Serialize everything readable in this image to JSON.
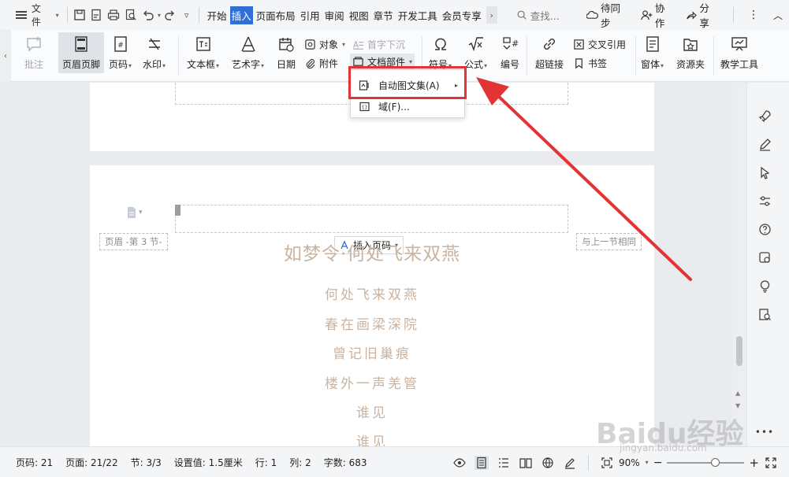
{
  "menubar": {
    "file_label": "文件",
    "tabs": [
      "开始",
      "插入",
      "页面布局",
      "引用",
      "审阅",
      "视图",
      "章节",
      "开发工具",
      "会员专享"
    ],
    "active_tab": "插入",
    "search_placeholder": "查找...",
    "sync_label": "待同步",
    "collab_label": "协作",
    "share_label": "分享"
  },
  "ribbon": {
    "comment": "批注",
    "header_footer": "页眉页脚",
    "page_number": "页码",
    "watermark": "水印",
    "textbox": "文本框",
    "wordart": "艺术字",
    "date": "日期",
    "object": "对象",
    "attachment": "附件",
    "drop_cap": "首字下沉",
    "doc_parts": "文档部件",
    "symbol": "符号",
    "formula": "公式",
    "numbering": "编号",
    "hyperlink": "超链接",
    "cross_ref": "交叉引用",
    "bookmark": "书签",
    "form": "窗体",
    "resources": "资源夹",
    "teaching_tools": "教学工具"
  },
  "dropdown": {
    "items": [
      "自动图文集(A)",
      "域(F)..."
    ]
  },
  "document": {
    "header_label": "页眉  -第 3 节-",
    "insert_page_number": "插入页码",
    "same_as_prev": "与上一节相同",
    "title": "如梦令·何处飞来双燕",
    "lines": [
      "何处飞来双燕",
      "春在画梁深院",
      "曾记旧巢痕",
      "楼外一声羌管",
      "谁见",
      "谁见"
    ]
  },
  "statusbar": {
    "page_code": "页码: 21",
    "pages": "页面: 21/22",
    "section": "节: 3/3",
    "setting": "设置值: 1.5厘米",
    "row": "行: 1",
    "col": "列: 2",
    "word_count": "字数: 683",
    "zoom": "90%"
  },
  "watermark": {
    "brand": "Baidu经验",
    "url": "jingyan.baidu.com"
  },
  "colors": {
    "accent": "#2f6fd6",
    "highlight_red": "#e23434",
    "poem_text": "#c9b3a1"
  }
}
